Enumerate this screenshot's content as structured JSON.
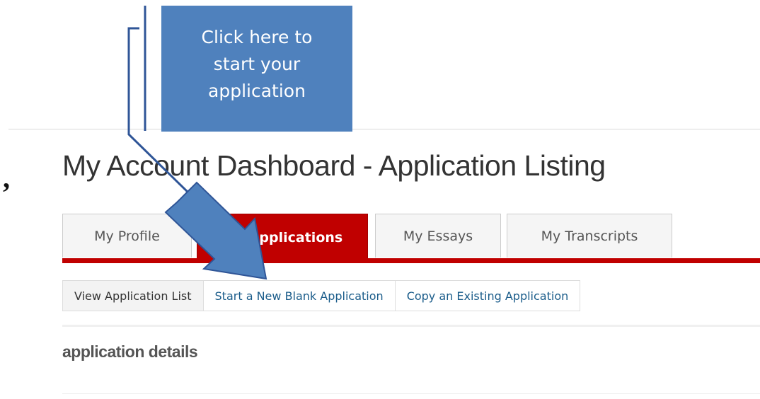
{
  "callout": {
    "lines": [
      "Click here to",
      "start your",
      "application"
    ]
  },
  "page": {
    "title": "My Account Dashboard - Application Listing",
    "section_heading": "application details"
  },
  "tabs": [
    {
      "label": "My Profile",
      "active": false
    },
    {
      "label": "My Applications",
      "active": true
    },
    {
      "label": "My Essays",
      "active": false
    },
    {
      "label": "My Transcripts",
      "active": false
    }
  ],
  "subnav": [
    {
      "label": "View Application List",
      "selected": true
    },
    {
      "label": "Start a New Blank Application",
      "selected": false
    },
    {
      "label": "Copy an Existing Application",
      "selected": false
    }
  ],
  "colors": {
    "accent_red": "#c00000",
    "callout_blue": "#4f81bd",
    "link_blue": "#1a5c8a"
  }
}
